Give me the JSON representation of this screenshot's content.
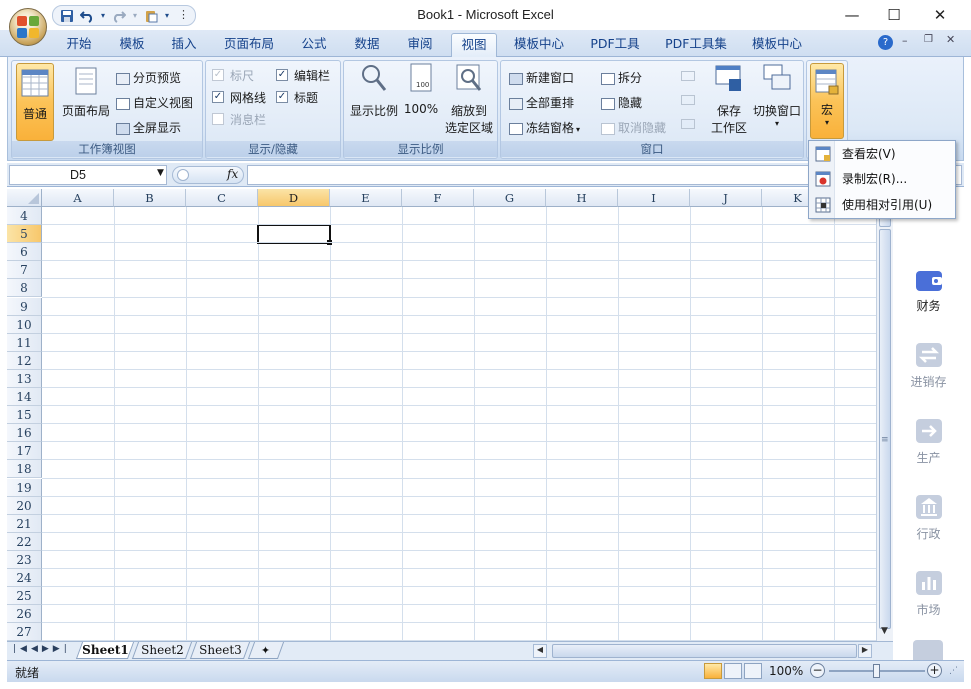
{
  "window": {
    "title": "Book1 - Microsoft Excel",
    "minimize": "—",
    "maximize": "☐",
    "close": "✕"
  },
  "qat": {
    "save_icon": "save-icon",
    "undo_icon": "undo-icon",
    "redo_icon": "redo-icon",
    "paste_icon": "paste-icon"
  },
  "tabs": [
    {
      "label": "开始"
    },
    {
      "label": "模板"
    },
    {
      "label": "插入"
    },
    {
      "label": "页面布局"
    },
    {
      "label": "公式"
    },
    {
      "label": "数据"
    },
    {
      "label": "审阅"
    },
    {
      "label": "视图",
      "active": true
    },
    {
      "label": "模板中心"
    },
    {
      "label": "PDF工具"
    },
    {
      "label": "PDF工具集"
    },
    {
      "label": "模板中心"
    }
  ],
  "ribbon": {
    "workbook_views": {
      "label": "工作簿视图",
      "normal": "普通",
      "page_layout": "页面布局",
      "page_break": "分页预览",
      "custom_view": "自定义视图",
      "full_screen": "全屏显示"
    },
    "show_hide": {
      "label": "显示/隐藏",
      "ruler": "标尺",
      "formula_bar": "编辑栏",
      "gridlines": "网格线",
      "headings": "标题",
      "message_bar": "消息栏"
    },
    "zoom": {
      "label": "显示比例",
      "zoom": "显示比例",
      "hundred": "100%",
      "zoom_selection_1": "缩放到",
      "zoom_selection_2": "选定区域"
    },
    "window": {
      "label": "窗口",
      "new_window": "新建窗口",
      "arrange_all": "全部重排",
      "freeze_panes": "冻结窗格",
      "split": "拆分",
      "hide": "隐藏",
      "unhide": "取消隐藏",
      "save_workspace_1": "保存",
      "save_workspace_2": "工作区",
      "switch_windows": "切换窗口"
    },
    "macros": {
      "label": "宏"
    }
  },
  "macro_menu": {
    "view_macros": "查看宏(V)",
    "record_macro": "录制宏(R)...",
    "relative_refs": "使用相对引用(U)"
  },
  "formula_bar": {
    "name_box": "D5",
    "fx": "fx",
    "formula": ""
  },
  "grid": {
    "columns": [
      "A",
      "B",
      "C",
      "D",
      "E",
      "F",
      "G",
      "H",
      "I",
      "J",
      "K"
    ],
    "rows": [
      "4",
      "5",
      "6",
      "7",
      "8",
      "9",
      "10",
      "11",
      "12",
      "13",
      "14",
      "15",
      "16",
      "17",
      "18",
      "19",
      "20",
      "21",
      "22",
      "23",
      "24",
      "25",
      "26",
      "27"
    ],
    "selected_column": "D",
    "selected_row": "5"
  },
  "sheets": [
    {
      "label": "Sheet1",
      "active": true
    },
    {
      "label": "Sheet2"
    },
    {
      "label": "Sheet3"
    }
  ],
  "status": {
    "ready": "就绪",
    "zoom": "100%"
  },
  "side_panel": [
    {
      "label": "财务",
      "icon": "wallet-icon",
      "active": true
    },
    {
      "label": "进销存",
      "icon": "exchange-icon"
    },
    {
      "label": "生产",
      "icon": "arrow-right-icon"
    },
    {
      "label": "行政",
      "icon": "government-icon"
    },
    {
      "label": "市场",
      "icon": "bar-chart-icon"
    }
  ],
  "colors": {
    "accent": "#15428b",
    "selected_header": "#f7c76b",
    "side_active": "#4a6fd8",
    "side_inactive": "#c5cede"
  }
}
